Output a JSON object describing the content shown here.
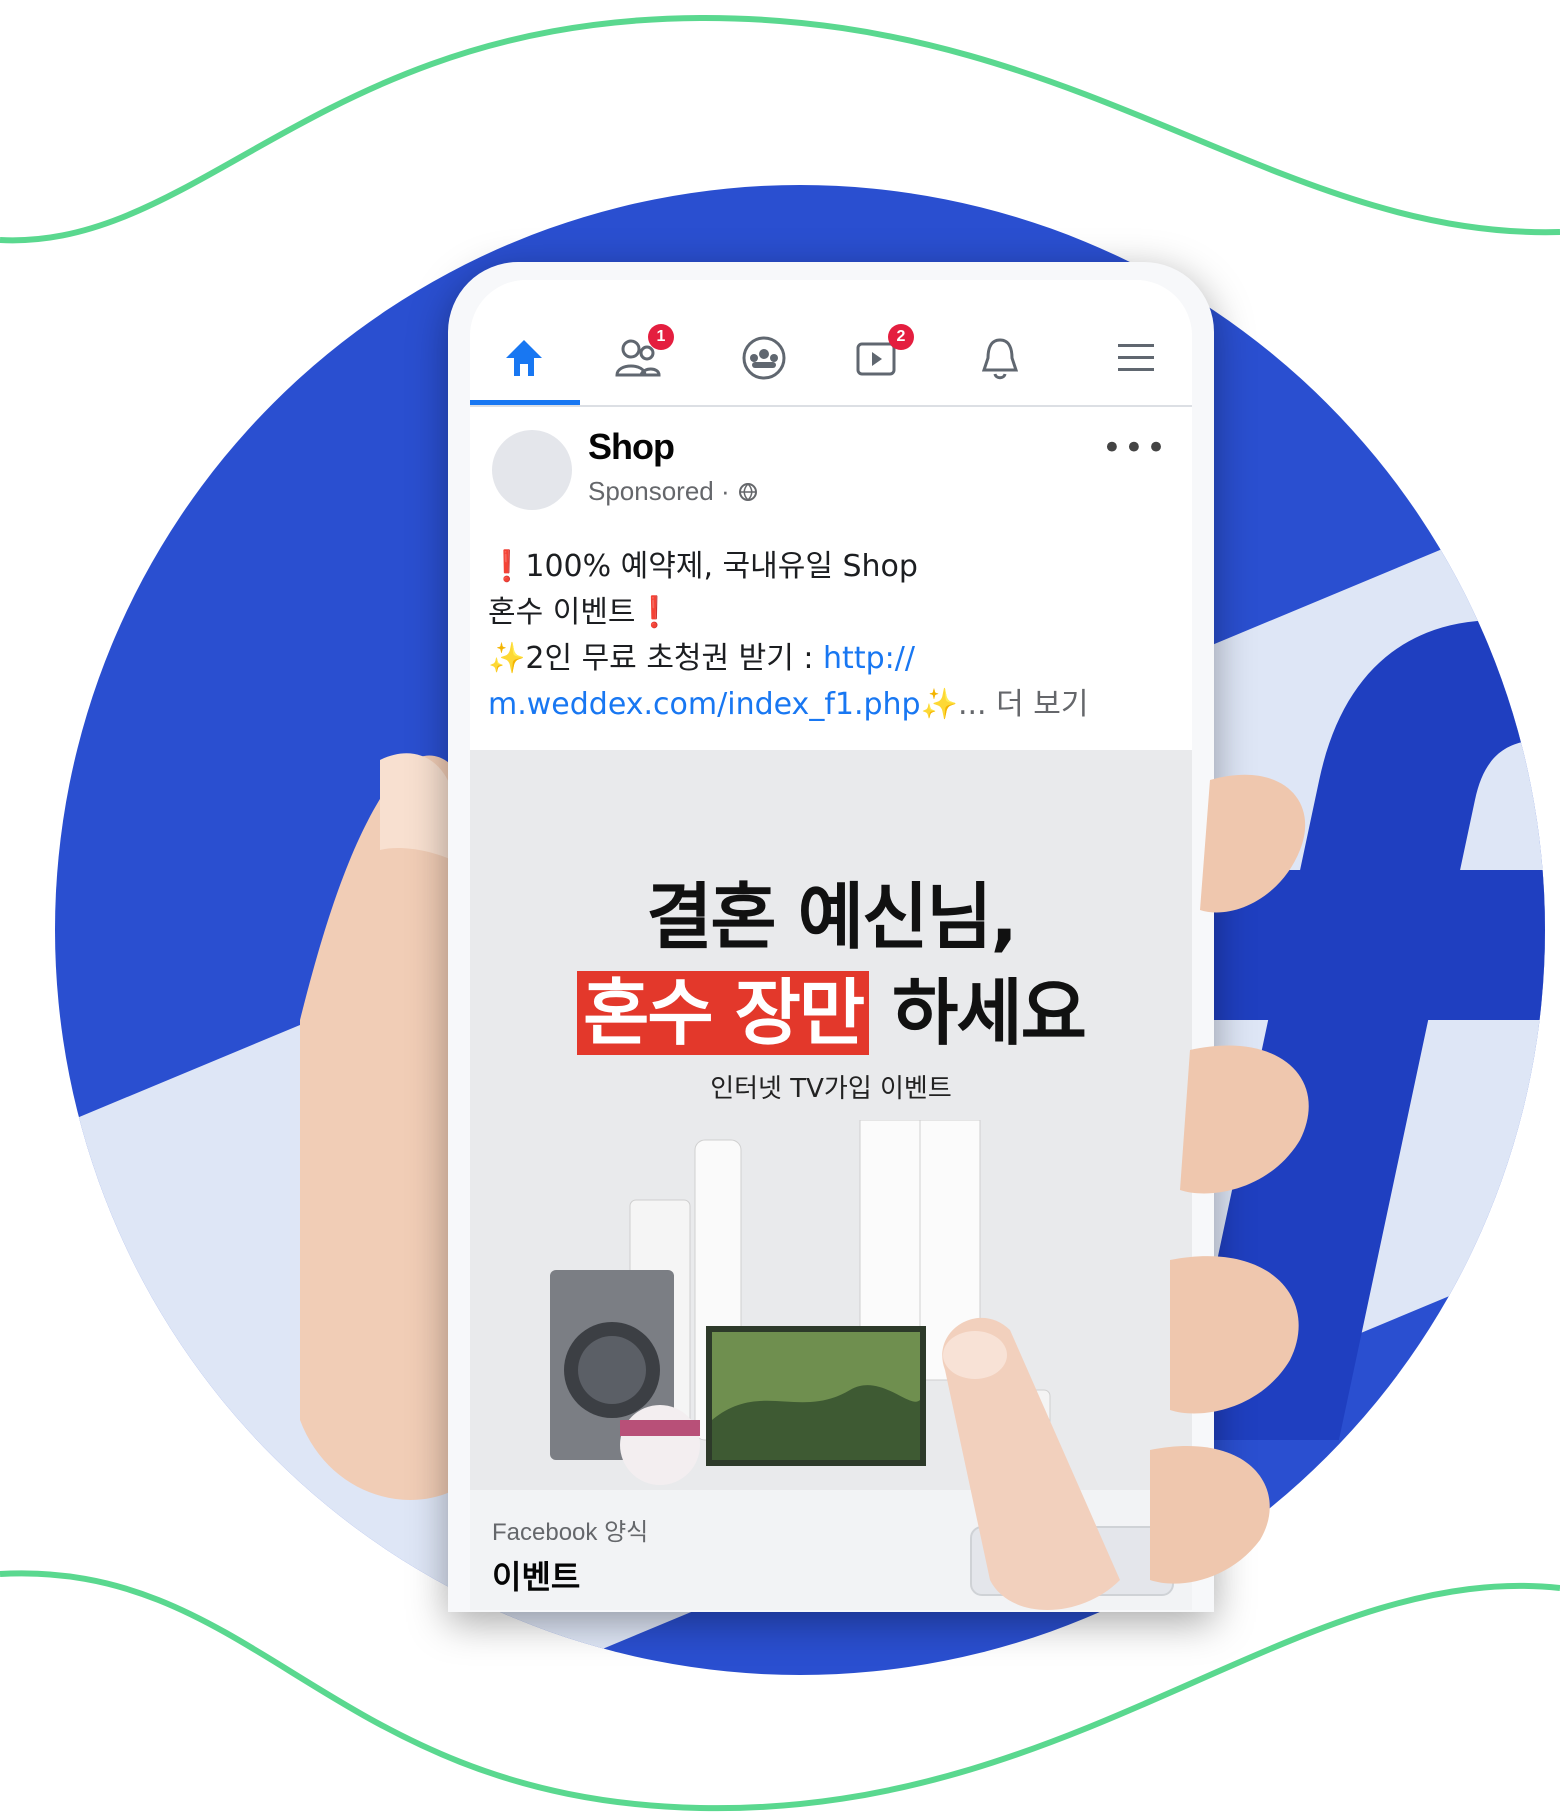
{
  "colors": {
    "brand_blue": "#2a4fd0",
    "wave_green": "#5ad88f",
    "fb_blue": "#1877f2",
    "badge_red": "#e41e3f",
    "highlight_red": "#e3382b"
  },
  "navbar": {
    "items": [
      {
        "icon": "home-icon",
        "active": true
      },
      {
        "icon": "friends-icon",
        "badge": "1"
      },
      {
        "icon": "groups-icon"
      },
      {
        "icon": "watch-icon",
        "badge": "2"
      },
      {
        "icon": "bell-icon"
      },
      {
        "icon": "menu-icon"
      }
    ]
  },
  "post": {
    "page_name": "Shop",
    "sponsored": "Sponsored · ",
    "text": {
      "line1_mark": "❗",
      "line1": "100% 예약제, 국내유일 Shop",
      "line2": "혼수 이벤트",
      "line2_mark": "❗",
      "line3_mark": "✨",
      "line3": "2인 무료 초청권 받기 : ",
      "line3_link": "http://",
      "line4_link": "m.weddex.com/index_f1.php",
      "line4_mark": "✨",
      "line4_more": "... 더 보기"
    },
    "ad": {
      "headline1": "결혼 예신님,",
      "headline2_highlight": "혼수 장만",
      "headline2_rest": " 하세요",
      "subline": "인터넷 TV가입 이벤트"
    },
    "footer": {
      "caption": "Facebook 양식",
      "title": "이벤트"
    }
  }
}
